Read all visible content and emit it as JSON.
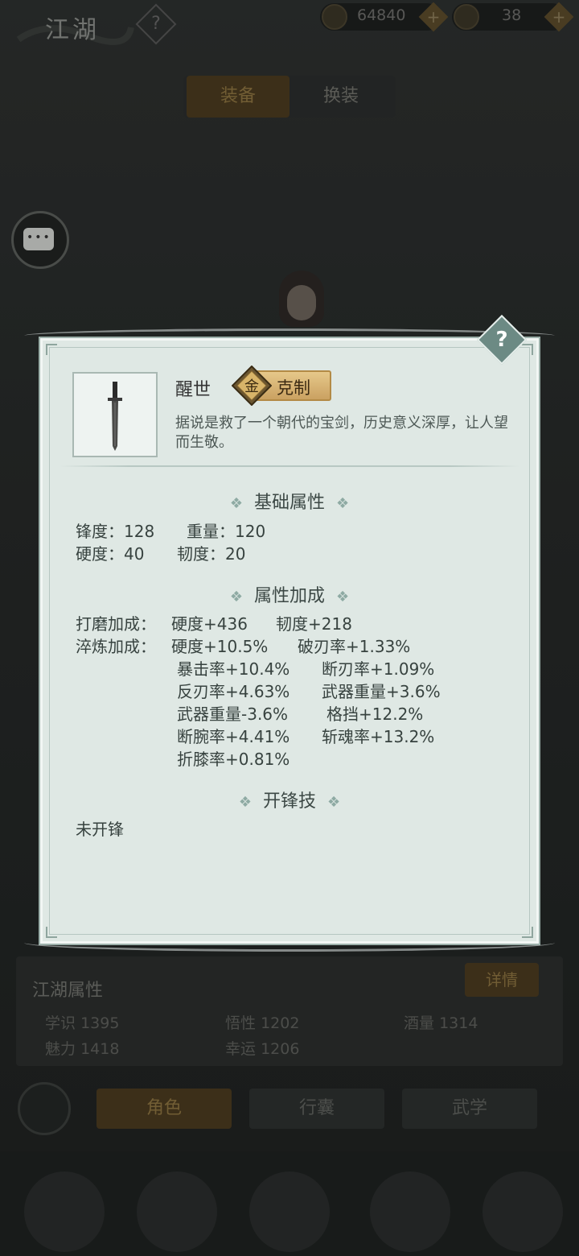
{
  "background": {
    "title": "江湖",
    "help_label": "?",
    "currency": [
      {
        "icon": "coin-icon",
        "value": "64840"
      },
      {
        "icon": "ingot-icon",
        "value": "38"
      }
    ],
    "tabs": [
      "装备",
      "换装"
    ],
    "jianghu": {
      "title": "江湖属性",
      "detail_label": "详情",
      "attributes": [
        {
          "name": "学识",
          "value": "1395"
        },
        {
          "name": "悟性",
          "value": "1202"
        },
        {
          "name": "酒量",
          "value": "1314"
        },
        {
          "name": "魅力",
          "value": "1418"
        },
        {
          "name": "幸运",
          "value": "1206"
        }
      ]
    },
    "nav": [
      "角色",
      "行囊",
      "武学"
    ]
  },
  "modal": {
    "help_label": "?",
    "item": {
      "name": "醒世",
      "tag_icon": "金",
      "tag_label": "克制",
      "description": "据说是救了一个朝代的宝剑，历史意义深厚，让人望而生敬。"
    },
    "base_section": {
      "title": "基础属性",
      "attributes": [
        {
          "label": "锋度：128"
        },
        {
          "label": "重量：120"
        },
        {
          "label": "硬度：40"
        },
        {
          "label": "韧度：20"
        }
      ]
    },
    "bonus_section": {
      "title": "属性加成",
      "grinding_label": "打磨加成：",
      "grinding": [
        "硬度+436",
        "韧度+218"
      ],
      "tempering_label": "淬炼加成：",
      "tempering": [
        "硬度+10.5%",
        "破刃率+1.33%",
        "暴击率+10.4%",
        "断刃率+1.09%",
        "反刃率+4.63%",
        "武器重量+3.6%",
        "武器重量-3.6%",
        "格挡+12.2%",
        "断腕率+4.41%",
        "斩魂率+13.2%",
        "折膝率+0.81%"
      ]
    },
    "skill_section": {
      "title": "开锋技",
      "content": "未开锋"
    },
    "ornament": "❖"
  }
}
